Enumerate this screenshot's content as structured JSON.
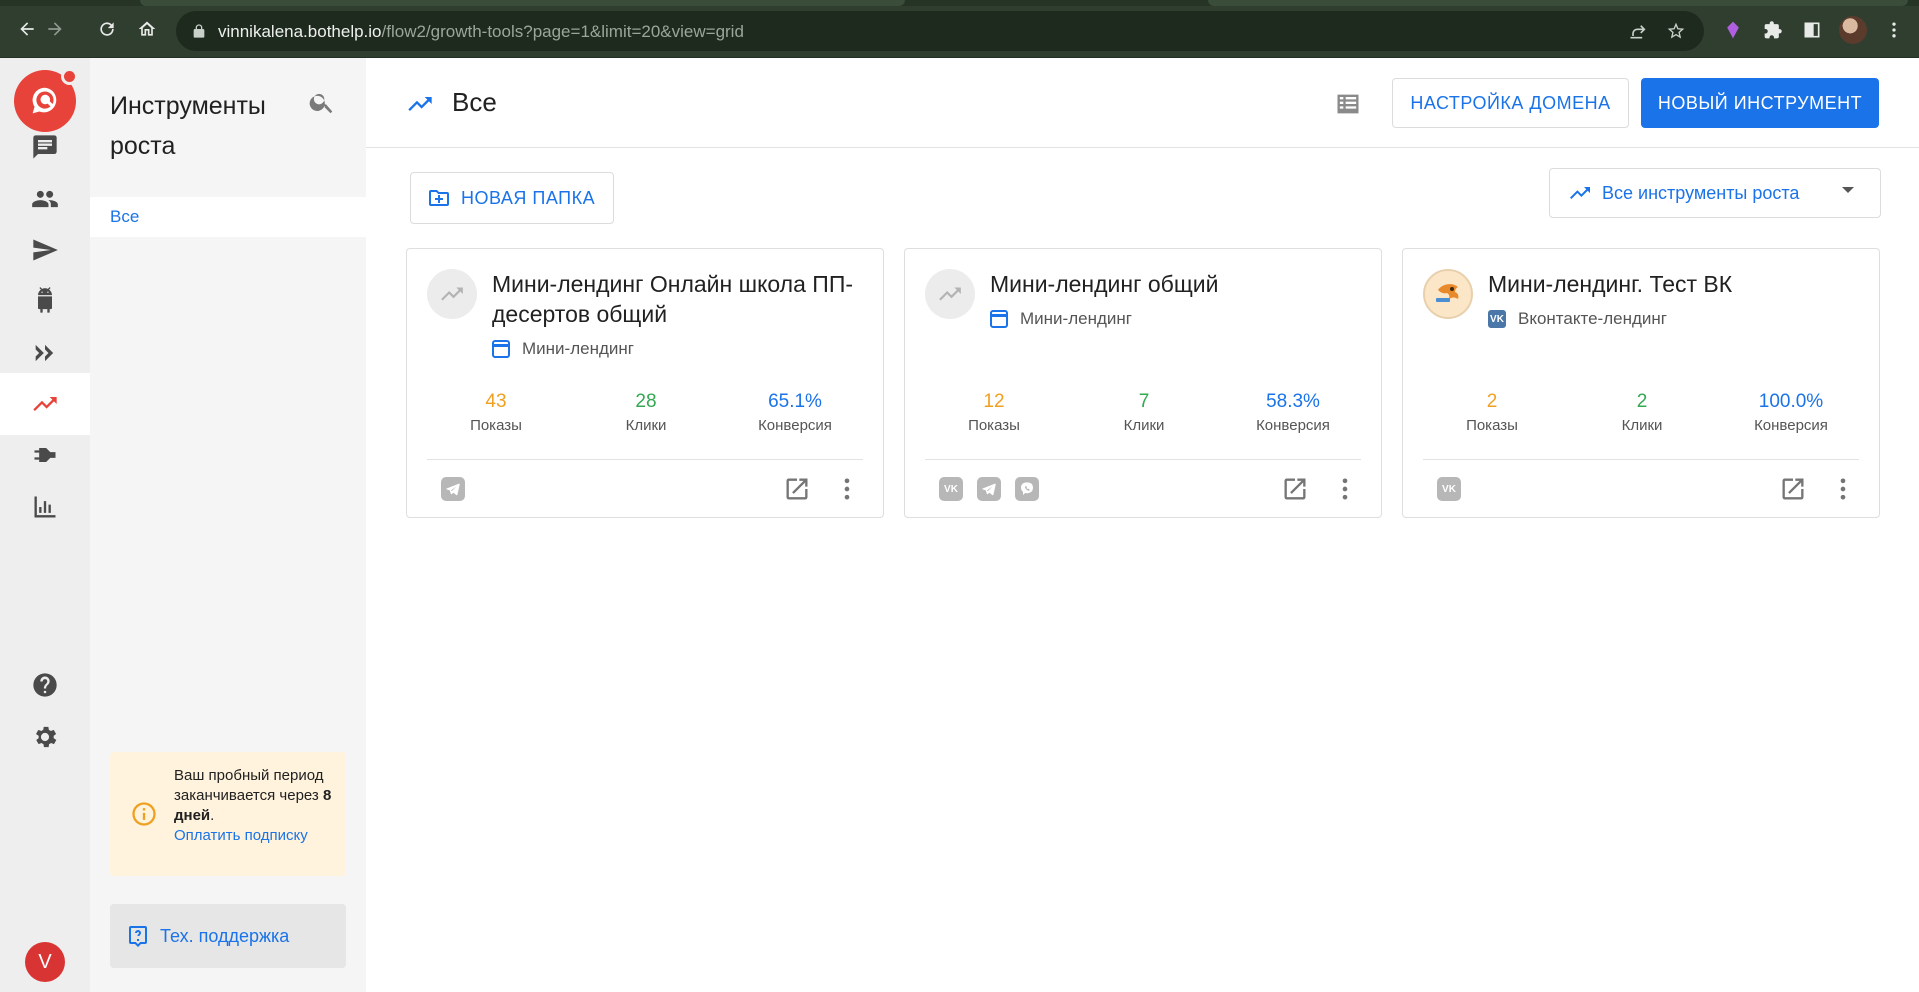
{
  "browser": {
    "url_host": "vinnikalena.bothelp.io",
    "url_path": "/flow2/growth-tools?page=1&limit=20&view=grid"
  },
  "rail": {
    "items": [
      "chats",
      "contacts",
      "broadcasts",
      "bots",
      "autofunnels",
      "growth-tools",
      "integrations",
      "analytics"
    ],
    "avatar_letter": "V"
  },
  "sidebar": {
    "title": "Инструменты роста",
    "folders": [
      {
        "label": "Все"
      }
    ],
    "trial": {
      "line1": "Ваш пробный период заканчивается через ",
      "days": "8 дней",
      "dot": ".",
      "link": "Оплатить подписку"
    },
    "support_label": "Тех. поддержка"
  },
  "header": {
    "title": "Все",
    "domain_button": "НАСТРОЙКА ДОМЕНА",
    "new_tool_button": "НОВЫЙ ИНСТРУМЕНТ"
  },
  "toolbar": {
    "new_folder": "НОВАЯ ПАПКА",
    "filter_value": "Все инструменты роста"
  },
  "cards": [
    {
      "name": "Мини-лендинг Онлайн школа ПП-десертов общий",
      "type": "Мини-лендинг",
      "shows": "43",
      "shows_label": "Показы",
      "clicks": "28",
      "clicks_label": "Клики",
      "conversion": "65.1%",
      "conversion_label": "Конверсия",
      "channels": [
        "telegram"
      ]
    },
    {
      "name": "Мини-лендинг общий",
      "type": "Мини-лендинг",
      "shows": "12",
      "shows_label": "Показы",
      "clicks": "7",
      "clicks_label": "Клики",
      "conversion": "58.3%",
      "conversion_label": "Конверсия",
      "channels": [
        "vk",
        "telegram",
        "viber"
      ]
    },
    {
      "name": "Мини-лендинг. Тест ВК",
      "type": "Вконтакте-лендинг",
      "shows": "2",
      "shows_label": "Показы",
      "clicks": "2",
      "clicks_label": "Клики",
      "conversion": "100.0%",
      "conversion_label": "Конверсия",
      "channels": [
        "vk"
      ]
    }
  ],
  "colors": {
    "accent": "#1a73e8",
    "brand": "#e8433a",
    "shows": "#f0a020",
    "clicks": "#34a853",
    "conversion": "#1a73e8",
    "trial_bg": "#fff3dd"
  }
}
